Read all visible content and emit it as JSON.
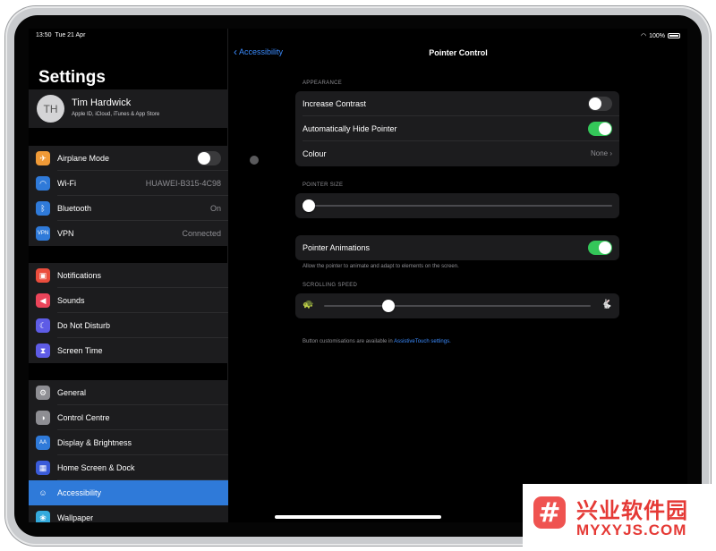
{
  "status_bar": {
    "time": "13:50",
    "date": "Tue 21 Apr",
    "battery": "100%"
  },
  "sidebar": {
    "title": "Settings",
    "profile": {
      "initials": "TH",
      "name": "Tim Hardwick",
      "subtitle": "Apple ID, iCloud, iTunes & App Store"
    },
    "groups": [
      [
        {
          "label": "Airplane Mode",
          "icon": "airplane-icon",
          "color": "#f09a37",
          "toggle": false
        },
        {
          "label": "Wi-Fi",
          "icon": "wifi-icon",
          "color": "#2f7ad9",
          "value": "HUAWEI-B315-4C98"
        },
        {
          "label": "Bluetooth",
          "icon": "bluetooth-icon",
          "color": "#2f7ad9",
          "value": "On"
        },
        {
          "label": "VPN",
          "icon": "vpn-icon",
          "color": "#2f7ad9",
          "value": "Connected"
        }
      ],
      [
        {
          "label": "Notifications",
          "icon": "notifications-icon",
          "color": "#eb4d3d"
        },
        {
          "label": "Sounds",
          "icon": "sounds-icon",
          "color": "#eb445a"
        },
        {
          "label": "Do Not Disturb",
          "icon": "moon-icon",
          "color": "#5e5ce6"
        },
        {
          "label": "Screen Time",
          "icon": "hourglass-icon",
          "color": "#5e5ce6"
        }
      ],
      [
        {
          "label": "General",
          "icon": "gear-icon",
          "color": "#8e8e93"
        },
        {
          "label": "Control Centre",
          "icon": "control-centre-icon",
          "color": "#8e8e93"
        },
        {
          "label": "Display & Brightness",
          "icon": "display-icon",
          "color": "#2f7ad9"
        },
        {
          "label": "Home Screen & Dock",
          "icon": "home-screen-icon",
          "color": "#3a5bd9"
        },
        {
          "label": "Accessibility",
          "icon": "accessibility-icon",
          "color": "#2f7ad9",
          "selected": true
        },
        {
          "label": "Wallpaper",
          "icon": "wallpaper-icon",
          "color": "#34aadc"
        }
      ]
    ]
  },
  "detail": {
    "back_label": "Accessibility",
    "title": "Pointer Control",
    "appearance_header": "APPEARANCE",
    "increase_contrast": {
      "label": "Increase Contrast",
      "on": false
    },
    "auto_hide": {
      "label": "Automatically Hide Pointer",
      "on": true
    },
    "colour": {
      "label": "Colour",
      "value": "None"
    },
    "pointer_size_header": "POINTER SIZE",
    "pointer_size_value": 0.0,
    "pointer_animations": {
      "label": "Pointer Animations",
      "on": true
    },
    "animations_footnote": "Allow the pointer to animate and adapt to elements on the screen.",
    "scrolling_speed_header": "SCROLLING SPEED",
    "scrolling_speed_value": 0.24,
    "button_note_prefix": "Button customisations are available in ",
    "button_note_link": "AssistiveTouch settings."
  },
  "watermark": {
    "text_cn": "兴业软件园",
    "url": "MYXYJS.COM",
    "logo_glyph": "#"
  }
}
